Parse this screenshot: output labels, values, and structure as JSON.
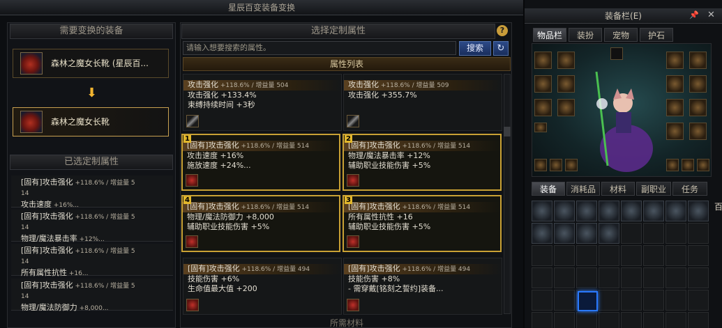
{
  "window": {
    "title": "星辰百变装备变换",
    "close": "×"
  },
  "left": {
    "need_header": "需要变换的装备",
    "source_item": "森林之魔女长靴 (星辰百...",
    "arrow": "⬇",
    "target_item": "森林之魔女长靴",
    "selected_header": "已选定制属性",
    "selected": [
      {
        "line1": "[固有]攻击强化",
        "line1b": " +118.6% / 增益量 5",
        "line2": "14",
        "line3": "攻击速度",
        "line3b": " +16%..."
      },
      {
        "line1": "[固有]攻击强化",
        "line1b": " +118.6% / 增益量 5",
        "line2": "14",
        "line3": "物理/魔法暴击率",
        "line3b": " +12%..."
      },
      {
        "line1": "[固有]攻击强化",
        "line1b": " +118.6% / 增益量 5",
        "line2": "14",
        "line3": "所有属性抗性",
        "line3b": " +16..."
      },
      {
        "line1": "[固有]攻击强化",
        "line1b": " +118.6% / 增益量 5",
        "line2": "14",
        "line3": "物理/魔法防御力",
        "line3b": " +8,000..."
      }
    ]
  },
  "right": {
    "header": "选择定制属性",
    "help": "?",
    "search_placeholder": "请输入想要搜索的属性。",
    "search_button": "搜索",
    "refresh": "↻",
    "list_header": "属性列表",
    "bottom_label": "所需材料",
    "cards": [
      {
        "num": "",
        "l1a": "攻击强化",
        "l1b": " +118.6% / 增益量 504",
        "l2": "攻击强化 +133.4%",
        "l3": "束缚持续时间 +3秒",
        "icon": "pipe-icon"
      },
      {
        "num": "",
        "l1a": "攻击强化",
        "l1b": " +118.6% / 增益量 509",
        "l2": "攻击强化 +355.7%",
        "l3": "",
        "icon": "pipe-icon"
      },
      {
        "num": "1",
        "l1a": "[固有]攻击强化",
        "l1b": " +118.6% / 增益量 514",
        "l2": "攻击速度 +16%",
        "l3": "施放速度 +24%...",
        "icon": "boot-icon"
      },
      {
        "num": "2",
        "l1a": "[固有]攻击强化",
        "l1b": " +118.6% / 增益量 514",
        "l2": "物理/魔法暴击率 +12%",
        "l3": "辅助职业技能伤害 +5%",
        "icon": "boot-icon"
      },
      {
        "num": "4",
        "l1a": "[固有]攻击强化",
        "l1b": " +118.6% / 增益量 514",
        "l2": "物理/魔法防御力 +8,000",
        "l3": "辅助职业技能伤害 +5%",
        "icon": "boot-icon"
      },
      {
        "num": "3",
        "l1a": "[固有]攻击强化",
        "l1b": " +118.6% / 增益量 514",
        "l2": "所有属性抗性 +16",
        "l3": "辅助职业技能伤害 +5%",
        "icon": "boot-icon"
      },
      {
        "num": "",
        "l1a": "[固有]攻击强化",
        "l1b": " +118.6% / 增益量 494",
        "l2": "技能伤害 +6%",
        "l3": "生命值最大值 +200",
        "icon": "boot-icon"
      },
      {
        "num": "",
        "l1a": "[固有]攻击强化",
        "l1b": " +118.6% / 增益量 494",
        "l2": "技能伤害 +8%",
        "l3": "- 需穿戴[铭刻之誓约]装备...",
        "icon": "boot-icon"
      }
    ]
  },
  "equip": {
    "title": "装备栏(E)",
    "top_tabs": [
      "物品栏",
      "装扮",
      "宠物",
      "护石"
    ],
    "bottom_tabs": [
      "装备",
      "消耗品",
      "材料",
      "副职业",
      "任务"
    ],
    "side_char": "百"
  }
}
